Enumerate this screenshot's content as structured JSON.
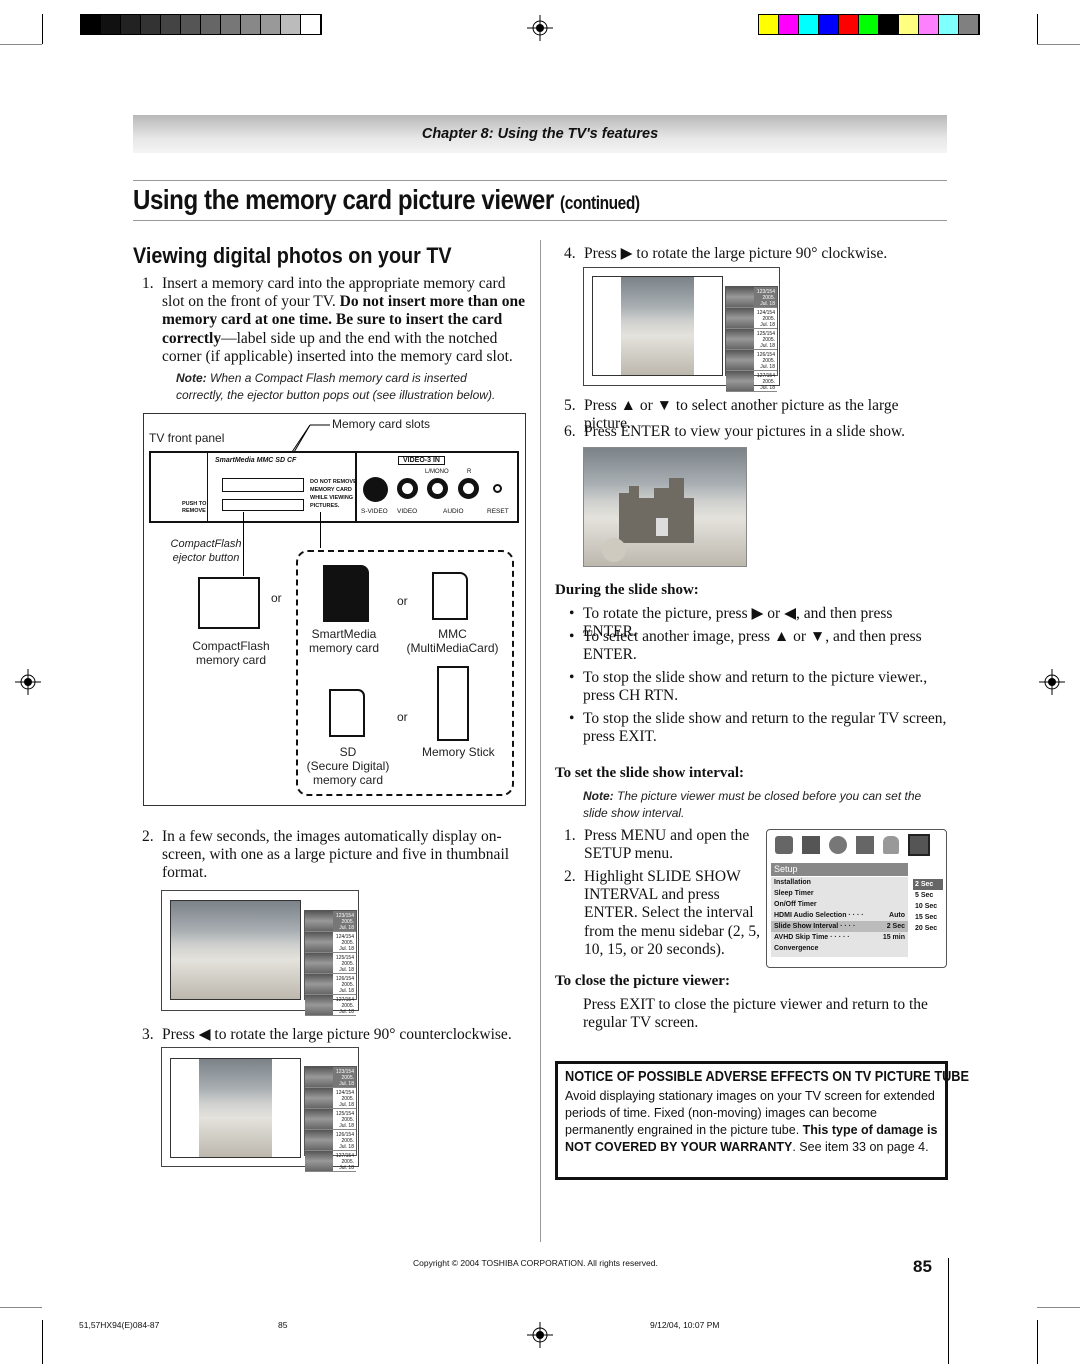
{
  "header": {
    "chapter": "Chapter 8: Using the TV's features"
  },
  "title": {
    "main": "Using the memory card picture viewer",
    "suffix": "(continued)"
  },
  "left": {
    "heading": "Viewing digital photos on your TV",
    "step1": {
      "num": "1.",
      "text_a": "Insert a memory card into the appropriate memory card slot on the front of your TV. ",
      "bold": "Do not insert more than one memory card at one time. Be sure to insert the card correctly",
      "text_b": "—label side up and the end with the notched corner (if applicable) inserted into the memory card slot."
    },
    "note": {
      "label": "Note:",
      "text": "When a Compact Flash memory card is inserted correctly, the ejector button pops out (see illustration below)."
    },
    "diagram": {
      "panel_label": "TV front panel",
      "slots_label": "Memory card slots",
      "logos": "SmartMedia  MMC  SD  CF",
      "warning": "DO NOT REMOVE MEMORY CARD WHILE VIEWING PICTURES.",
      "video_in": "VIDEO-3 IN",
      "lmono": "L/MONO",
      "r": "R",
      "svideo": "S-VIDEO",
      "video": "VIDEO",
      "audio": "AUDIO",
      "reset": "RESET",
      "push": "PUSH TO REMOVE",
      "cf_small": "CF",
      "ejector": "CompactFlash ejector button",
      "or": "or",
      "cards": [
        {
          "name": "CompactFlash",
          "sub": "memory card"
        },
        {
          "name": "SmartMedia",
          "sub": "memory card"
        },
        {
          "name": "MMC",
          "sub": "(MultiMediaCard)"
        },
        {
          "name": "SD",
          "sub": "(Secure Digital)",
          "sub2": "memory card"
        },
        {
          "name": "Memory Stick",
          "sub": ""
        }
      ]
    },
    "step2": {
      "num": "2.",
      "text": "In a few seconds, the images automatically display on-screen, with one as a large picture and five in thumbnail format."
    },
    "step3": {
      "num": "3.",
      "text_a": "Press",
      "icon": "◀",
      "text_b": "to rotate the large picture 90° counterclockwise."
    }
  },
  "thumbnails": [
    {
      "id": "123/154",
      "date": "2005. Jul. 18"
    },
    {
      "id": "124/154",
      "date": "2005. Jul. 18"
    },
    {
      "id": "125/154",
      "date": "2005. Jul. 18"
    },
    {
      "id": "126/154",
      "date": "2005. Jul. 18"
    },
    {
      "id": "127/154",
      "date": "2005. Jul. 18"
    }
  ],
  "right": {
    "step4": {
      "num": "4.",
      "text_a": "Press",
      "icon": "▶",
      "text_b": "to rotate the large picture 90° clockwise."
    },
    "step5": {
      "num": "5.",
      "text": "Press ▲ or ▼ to select another picture as the large picture."
    },
    "step6": {
      "num": "6.",
      "text": "Press ENTER to view your pictures in a slide show."
    },
    "during_heading": "During the slide show:",
    "bullets": [
      "To rotate the picture, press ▶ or ◀, and then press ENTER.",
      "To select another image, press ▲ or ▼, and then press ENTER.",
      "To stop the slide show and return to the picture viewer., press CH RTN.",
      "To stop the slide show and return to the regular TV screen, press EXIT."
    ],
    "interval_heading": "To set the slide show interval:",
    "interval_note": {
      "label": "Note:",
      "text": "The picture viewer must be closed before you can set the slide show interval."
    },
    "istep1": {
      "num": "1.",
      "text": "Press MENU and open the SETUP menu."
    },
    "istep2": {
      "num": "2.",
      "text": "Highlight SLIDE SHOW INTERVAL and press ENTER. Select the interval from the menu sidebar (2, 5, 10, 15, or 20 seconds)."
    },
    "close_heading": "To close the picture viewer:",
    "close_text": "Press EXIT to close the picture viewer and return to the regular TV screen."
  },
  "menu": {
    "title": "Setup",
    "items": [
      {
        "label": "Installation",
        "value": ""
      },
      {
        "label": "Sleep Timer",
        "value": ""
      },
      {
        "label": "On/Off Timer",
        "value": ""
      },
      {
        "label": "HDMI Audio Selection · · · ·",
        "value": "Auto"
      },
      {
        "label": "Slide Show Interval · · · ·",
        "value": "2 Sec"
      },
      {
        "label": "AVHD Skip Time · · · · ·",
        "value": "15 min"
      },
      {
        "label": "Convergence",
        "value": ""
      }
    ],
    "options": [
      "2 Sec",
      "5 Sec",
      "10 Sec",
      "15 Sec",
      "20 Sec"
    ]
  },
  "notice": {
    "title": "NOTICE OF POSSIBLE ADVERSE EFFECTS ON TV PICTURE TUBE",
    "text_a": "Avoid displaying stationary images on your TV screen for extended periods of time. Fixed (non-moving) images can become permanently engrained in the picture tube. ",
    "bold": "This type of damage is NOT COVERED BY YOUR WARRANTY",
    "text_b": ". See item 33 on page 4."
  },
  "footer": {
    "copyright": "Copyright © 2004 TOSHIBA CORPORATION. All rights reserved.",
    "page": "85",
    "slug": "51,57HX94(E)084-87",
    "slug_page": "85",
    "date": "9/12/04, 10:07 PM"
  },
  "colors": {
    "gray_bar": [
      "#000",
      "#111",
      "#222",
      "#333",
      "#444",
      "#555",
      "#666",
      "#777",
      "#888",
      "#999",
      "#bbb",
      "#fff"
    ],
    "color_bar": [
      "#ffff00",
      "#ff00ff",
      "#00ffff",
      "#0000ff",
      "#ff0000",
      "#00ff00",
      "#000000",
      "#ffff80",
      "#ff80ff",
      "#80ffff",
      "#808080"
    ]
  }
}
